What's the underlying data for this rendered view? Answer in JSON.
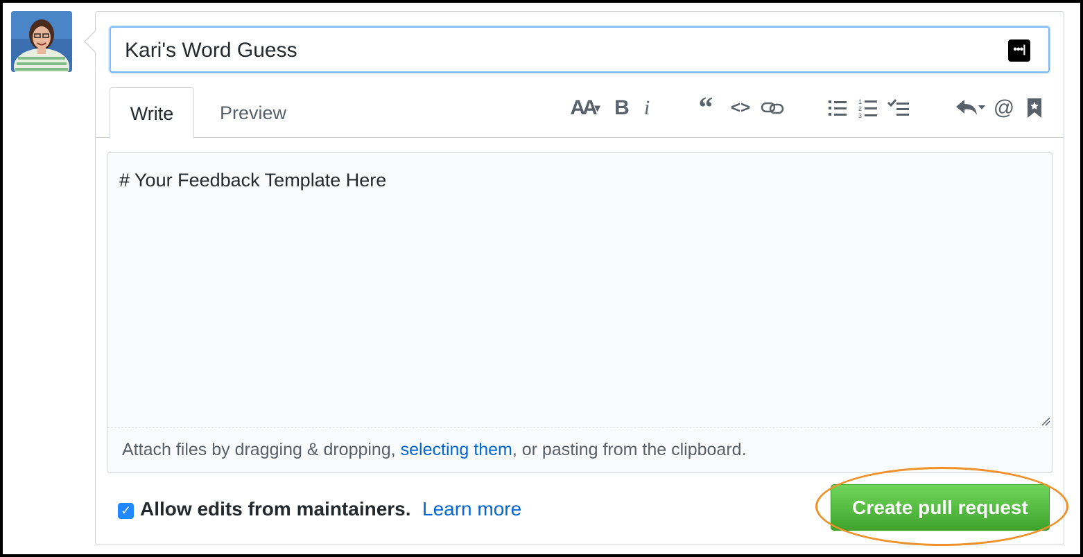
{
  "title_input": {
    "value": "Kari's Word Guess",
    "icon": "password-manager-icon"
  },
  "tabs": [
    {
      "label": "Write",
      "active": true
    },
    {
      "label": "Preview",
      "active": false
    }
  ],
  "toolbar": {
    "heading": "AA",
    "bold": "B",
    "italic": "i",
    "quote": "“",
    "code": "<>",
    "link": "link-icon",
    "unordered_list": "unordered-list-icon",
    "ordered_list": "ordered-list-icon",
    "task_list": "task-list-icon",
    "reply": "reply-icon",
    "mention": "@",
    "bookmark": "bookmark-icon"
  },
  "body": {
    "content": "# Your Feedback Template Here",
    "attach_prefix": "Attach files by dragging & dropping, ",
    "attach_link": "selecting them",
    "attach_suffix": ", or pasting from the clipboard."
  },
  "footer": {
    "checkbox_checked": true,
    "allow_label": "Allow edits from maintainers.",
    "learn_more": "Learn more",
    "create_button": "Create pull request"
  },
  "colors": {
    "accent_blue": "#0366d6",
    "button_green": "#3fa32b",
    "highlight_orange": "#f0912a"
  }
}
